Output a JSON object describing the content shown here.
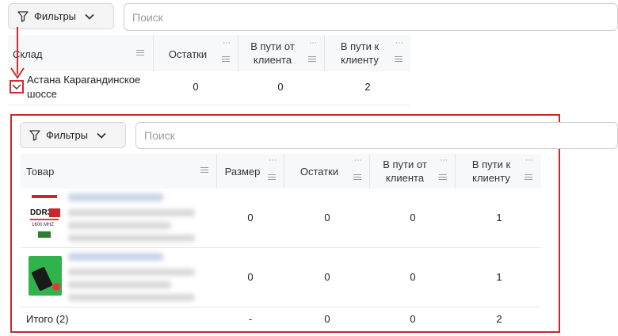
{
  "top": {
    "filter_label": "Фильтры",
    "search_placeholder": "Поиск",
    "columns": [
      "Склад",
      "Остатки",
      "В пути от клиента",
      "В пути к клиенту"
    ],
    "row": {
      "warehouse": "Астана Карагандинское шоссе",
      "stock": "0",
      "in_transit_from": "0",
      "in_transit_to": "2"
    }
  },
  "inner": {
    "filter_label": "Фильтры",
    "search_placeholder": "Поиск",
    "columns": [
      "Товар",
      "Размер",
      "Остатки",
      "В пути от клиента",
      "В пути к клиенту"
    ],
    "rows": [
      {
        "thumb_text": "DDR3",
        "thumb_sub": "1600 MHZ",
        "size": "0",
        "stock": "0",
        "in_transit_from": "0",
        "in_transit_to": "1"
      },
      {
        "thumb_text": "",
        "thumb_sub": "",
        "size": "0",
        "stock": "0",
        "in_transit_from": "0",
        "in_transit_to": "1"
      }
    ],
    "total": {
      "label": "Итого (2)",
      "size": "-",
      "stock": "0",
      "in_transit_from": "0",
      "in_transit_to": "2"
    }
  },
  "colors": {
    "annotation_red": "#d42a2a",
    "header_bg": "#f7f8fa"
  }
}
